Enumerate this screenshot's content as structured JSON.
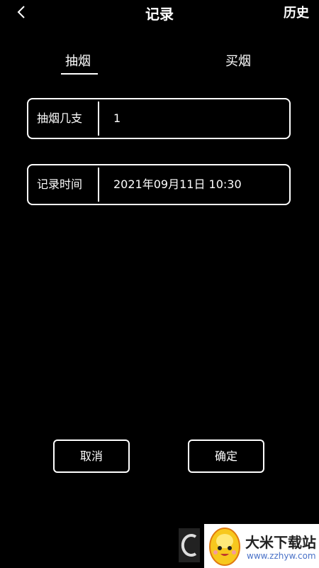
{
  "header": {
    "title": "记录",
    "history_label": "历史"
  },
  "tabs": [
    {
      "label": "抽烟",
      "active": true
    },
    {
      "label": "买烟",
      "active": false
    }
  ],
  "form": {
    "count": {
      "label": "抽烟几支",
      "value": "1"
    },
    "time": {
      "label": "记录时间",
      "value": "2021年09月11日 10:30"
    }
  },
  "buttons": {
    "cancel": "取消",
    "confirm": "确定"
  },
  "watermark": {
    "text": "大米下载站",
    "url": "www.zzhyw.com"
  }
}
